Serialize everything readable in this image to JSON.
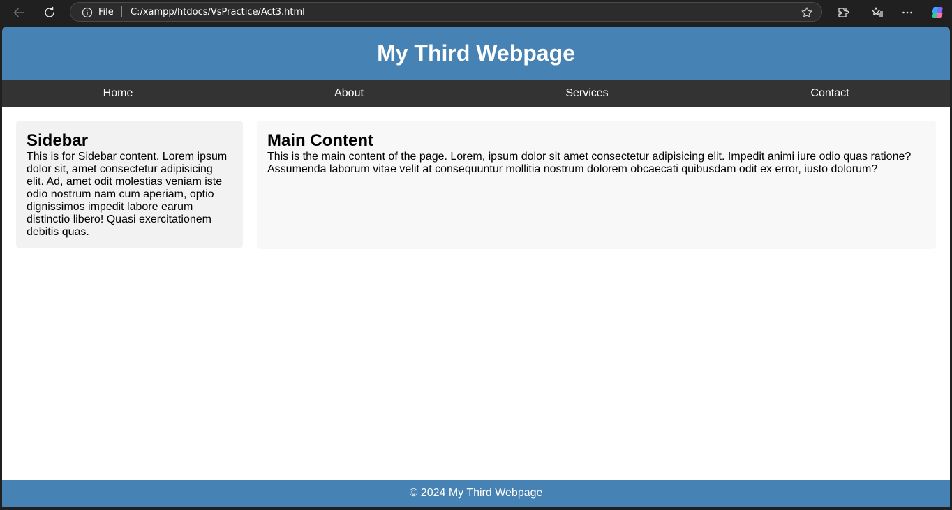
{
  "browser": {
    "address_scheme": "File",
    "address_url": "C:/xampp/htdocs/VsPractice/Act3.html",
    "icons": [
      "back-arrow-icon",
      "refresh-icon",
      "info-icon",
      "star-icon",
      "extensions-icon",
      "favorites-icon",
      "more-icon",
      "copilot-icon"
    ]
  },
  "page": {
    "title": "My Third Webpage",
    "nav": [
      "Home",
      "About",
      "Services",
      "Contact"
    ],
    "sidebar": {
      "heading": "Sidebar",
      "text": "This is for Sidebar content. Lorem ipsum dolor sit, amet consectetur adipisicing elit. Ad, amet odit molestias veniam iste odio nostrum nam cum aperiam, optio dignissimos impedit labore earum distinctio libero! Quasi exercitationem debitis quas."
    },
    "main": {
      "heading": "Main Content",
      "text": "This is the main content of the page. Lorem, ipsum dolor sit amet consectetur adipisicing elit. Impedit animi iure odio quas ratione? Assumenda laborum vitae velit at consequuntur mollitia nostrum dolorem obcaecati quibusdam odit ex error, iusto dolorum?"
    },
    "footer": "© 2024 My Third Webpage"
  },
  "colors": {
    "header": "#4682b4",
    "nav": "#333333",
    "sidebar_bg": "#f2f2f2",
    "main_bg": "#f8f8f8",
    "browser_chrome": "#202020"
  }
}
